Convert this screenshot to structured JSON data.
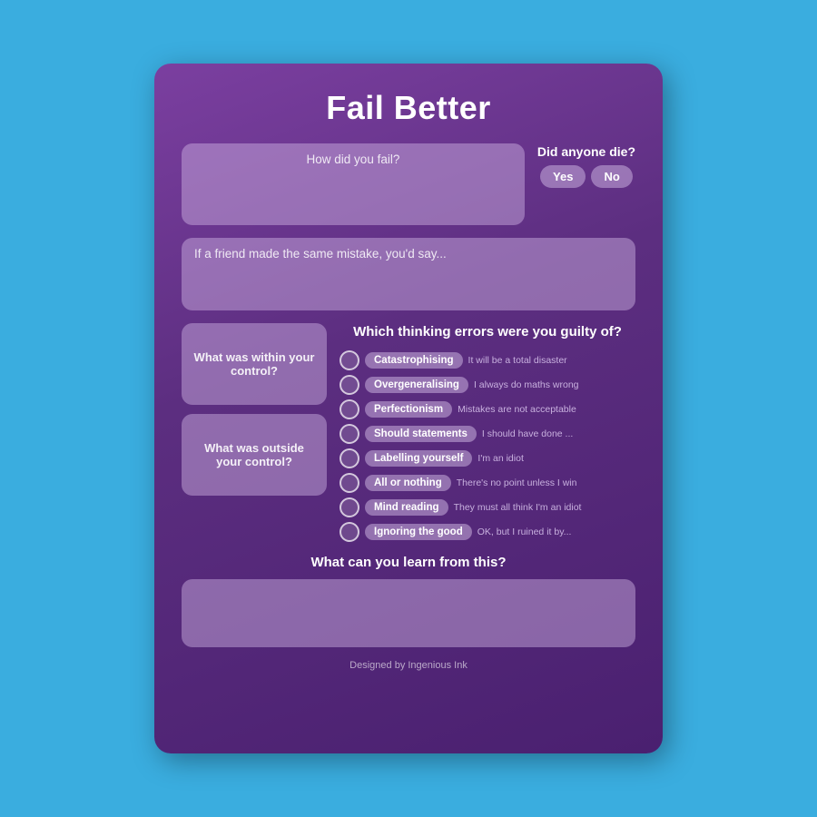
{
  "card": {
    "title": "Fail Better",
    "how_fail_label": "How did you fail?",
    "die_question": "Did anyone die?",
    "yes_label": "Yes",
    "no_label": "No",
    "friend_label": "If a friend made the same mistake, you'd say...",
    "within_control_label": "What was within your control?",
    "outside_control_label": "What was outside your control?",
    "thinking_title": "Which thinking errors were you guilty of?",
    "learn_title": "What can you learn from this?",
    "footer": "Designed by Ingenious Ink",
    "errors": [
      {
        "label": "Catastrophising",
        "desc": "It will be a total disaster"
      },
      {
        "label": "Overgeneralising",
        "desc": "I always do maths wrong"
      },
      {
        "label": "Perfectionism",
        "desc": "Mistakes are not acceptable"
      },
      {
        "label": "Should statements",
        "desc": "I should have done ..."
      },
      {
        "label": "Labelling yourself",
        "desc": "I'm an idiot"
      },
      {
        "label": "All or nothing",
        "desc": "There's no point unless I win"
      },
      {
        "label": "Mind reading",
        "desc": "They must all think I'm an idiot"
      },
      {
        "label": "Ignoring the good",
        "desc": "OK, but I ruined it by..."
      }
    ]
  }
}
